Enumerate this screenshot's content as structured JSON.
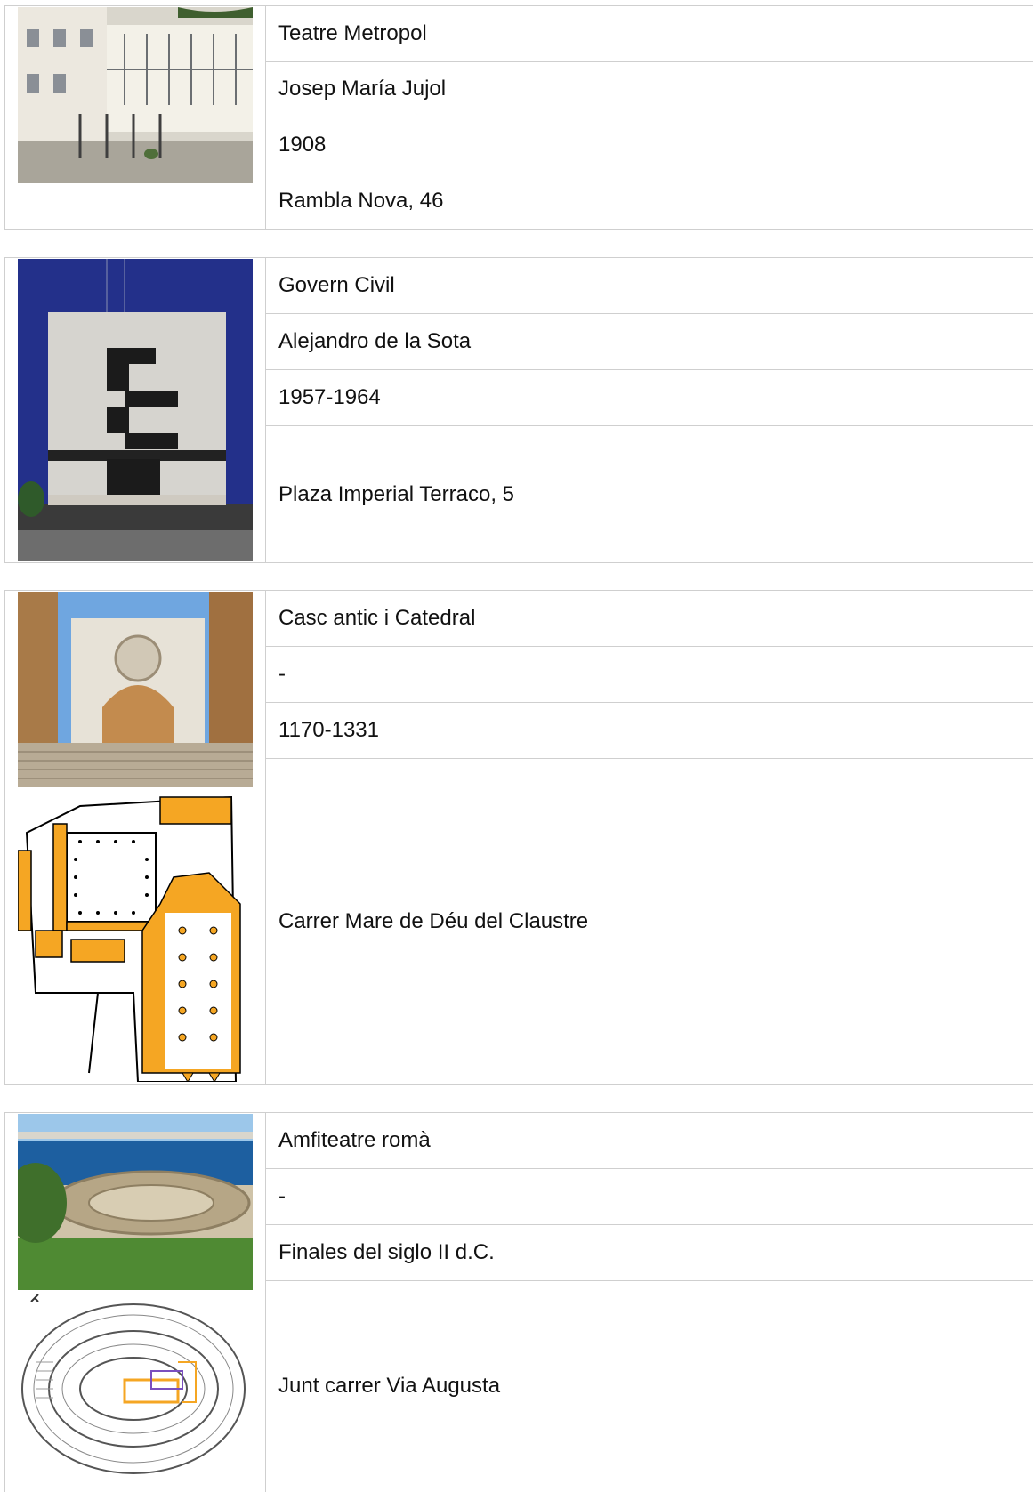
{
  "entries": [
    {
      "name": "Teatre Metropol",
      "architect": "Josep María Jujol",
      "year": "1908",
      "address": "Rambla Nova, 46"
    },
    {
      "name": "Govern Civil",
      "architect": "Alejandro de la Sota",
      "year": "1957-1964",
      "address": "Plaza Imperial Terraco, 5"
    },
    {
      "name": "Casc antic i Catedral",
      "architect": "-",
      "year": "1170-1331",
      "address": "Carrer Mare de Déu del Claustre"
    },
    {
      "name": "Amfiteatre romà",
      "architect": "-",
      "year": "Finales del siglo II d.C.",
      "address": "Junt carrer Via Augusta"
    }
  ],
  "colors": {
    "border": "#cfcfcf",
    "plan_fill": "#f5a623",
    "sky_blue": "#1f2f8f"
  }
}
